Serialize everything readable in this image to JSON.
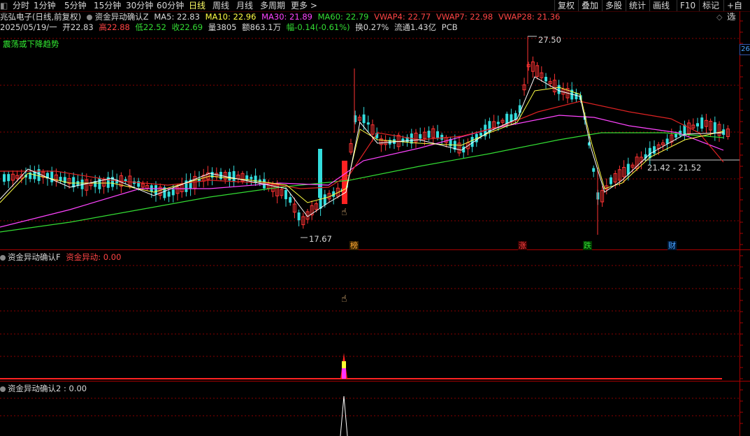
{
  "toolbar": {
    "tabs": [
      "分时",
      "1分钟",
      "5分钟",
      "15分钟",
      "30分钟",
      "60分钟",
      "日线",
      "周线",
      "月线",
      "多周期",
      "更多 >"
    ],
    "active_tab": "日线",
    "right_buttons": [
      "复权",
      "叠加",
      "多股",
      "统计",
      "画线",
      "F10",
      "标记",
      "+自选"
    ]
  },
  "stock": {
    "name": "兆弘电子(日线,前复权)",
    "indicator_name": "资金异动确认Z",
    "ma5": "MA5: 22.83",
    "ma10": "MA10: 22.96",
    "ma30": "MA30: 21.89",
    "ma60": "MA60: 22.79",
    "vwap4": "VWAP4: 22.77",
    "vwap7": "VWAP7: 22.98",
    "vwap28": "VWAP28: 21.36"
  },
  "quote": {
    "date": "2025/05/19/一",
    "open": "开22.83",
    "high": "高22.88",
    "low": "低22.52",
    "close": "收22.69",
    "volume": "量3805",
    "amount": "额863.1万",
    "change": "幅-0.14(-0.61%)",
    "turnover": "换0.27%",
    "float": "流通1.43亿",
    "sector": "PCB"
  },
  "trend_label": "震荡或下降趋势",
  "price_labels": {
    "high_peak": "27.50",
    "low_trough": "17.67",
    "range": "21.42 - 21.52",
    "right_axis": "26"
  },
  "event_tags": [
    {
      "text": "榜",
      "color": "#ffaa33"
    },
    {
      "text": "涨",
      "color": "#ff4444"
    },
    {
      "text": "跌",
      "color": "#33dd33"
    },
    {
      "text": "财",
      "color": "#4aa3ff"
    }
  ],
  "panel2": {
    "title": "资金异动确认F",
    "value_label": "资金异动: 0.00"
  },
  "panel3": {
    "title": "资金异动确认2 : 0.00"
  },
  "colors": {
    "up": "#ff3333",
    "down": "#33dddd",
    "ma5": "#ffffff",
    "ma10": "#ffff44",
    "ma30": "#ff44ff",
    "ma60": "#33dd33",
    "vwap": "#dd2222",
    "grid": "#8a0000"
  },
  "chart_data": {
    "type": "candlestick",
    "price_range": [
      17.67,
      27.5
    ],
    "markers": [
      "17.67",
      "27.50",
      "21.42 - 21.52"
    ]
  }
}
